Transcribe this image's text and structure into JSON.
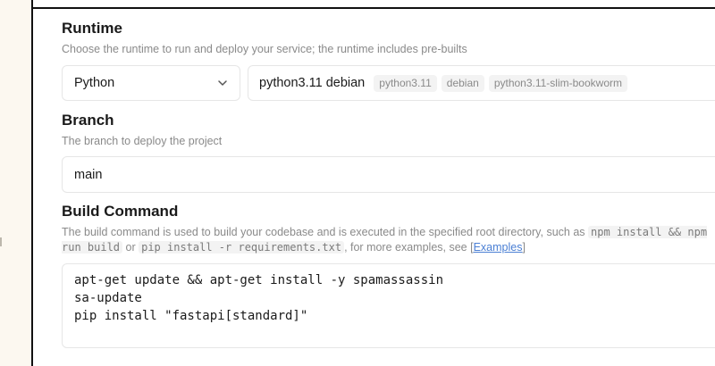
{
  "runtime": {
    "title": "Runtime",
    "description": "Choose the runtime to run and deploy your service; the runtime includes pre-builts",
    "selected_language": "Python",
    "version_label": "python3.11 debian",
    "tags": [
      "python3.11",
      "debian",
      "python3.11-slim-bookworm"
    ]
  },
  "branch": {
    "title": "Branch",
    "description": "The branch to deploy the project",
    "value": "main"
  },
  "build": {
    "title": "Build Command",
    "desc_part1": "The build command is used to build your codebase and is executed in the specified root directory, such as ",
    "code_example1": "npm install && npm run build",
    "desc_or": " or ",
    "code_example2": "pip install -r requirements.txt",
    "desc_part2": ", for more examples, see ",
    "link_open": "[",
    "link_text": "Examples",
    "link_close": "]",
    "commands": [
      "apt-get update && apt-get install -y spamassassin",
      "sa-update",
      "pip install \"fastapi[standard]\""
    ]
  },
  "icons": {
    "dropdown": "chevron-down-icon"
  },
  "colors": {
    "gutter": "#fcf8f0",
    "link": "#4a7fd4"
  }
}
